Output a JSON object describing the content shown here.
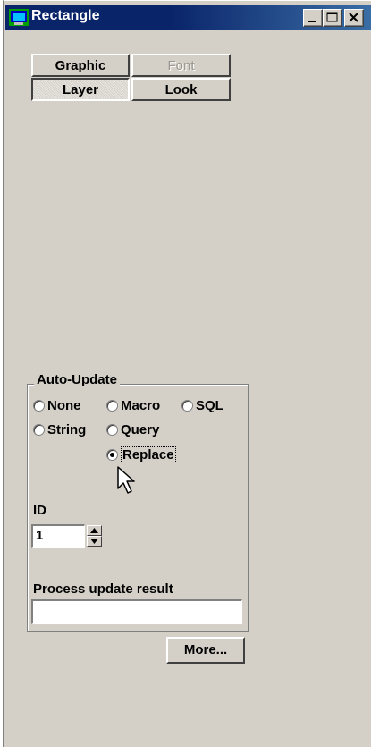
{
  "window": {
    "title": "Rectangle",
    "caption_buttons": [
      "minimize",
      "maximize",
      "close"
    ]
  },
  "tabs": [
    {
      "label": "Graphic",
      "mnemonic": "G",
      "state": "normal"
    },
    {
      "label": "Font",
      "mnemonic": "F",
      "state": "disabled"
    },
    {
      "label": "Layer",
      "mnemonic": "r",
      "state": "pressed"
    },
    {
      "label": "Look",
      "mnemonic": "L",
      "state": "normal"
    }
  ],
  "auto_update": {
    "group_label": "Auto-Update",
    "options": [
      {
        "label": "None",
        "selected": false
      },
      {
        "label": "Macro",
        "selected": false
      },
      {
        "label": "SQL",
        "selected": false
      },
      {
        "label": "String",
        "selected": false
      },
      {
        "label": "Query",
        "selected": false
      },
      {
        "label": "Replace",
        "selected": true
      }
    ],
    "id_label": "ID",
    "id_value": "1",
    "result_label": "Process update result",
    "result_value": ""
  },
  "more_button": {
    "label": "More...",
    "mnemonic": "M"
  },
  "icons": {
    "app": "rectangle-app-icon",
    "cursor": "arrow-cursor-icon",
    "spin_up": "up-arrow-icon",
    "spin_down": "down-arrow-icon"
  }
}
